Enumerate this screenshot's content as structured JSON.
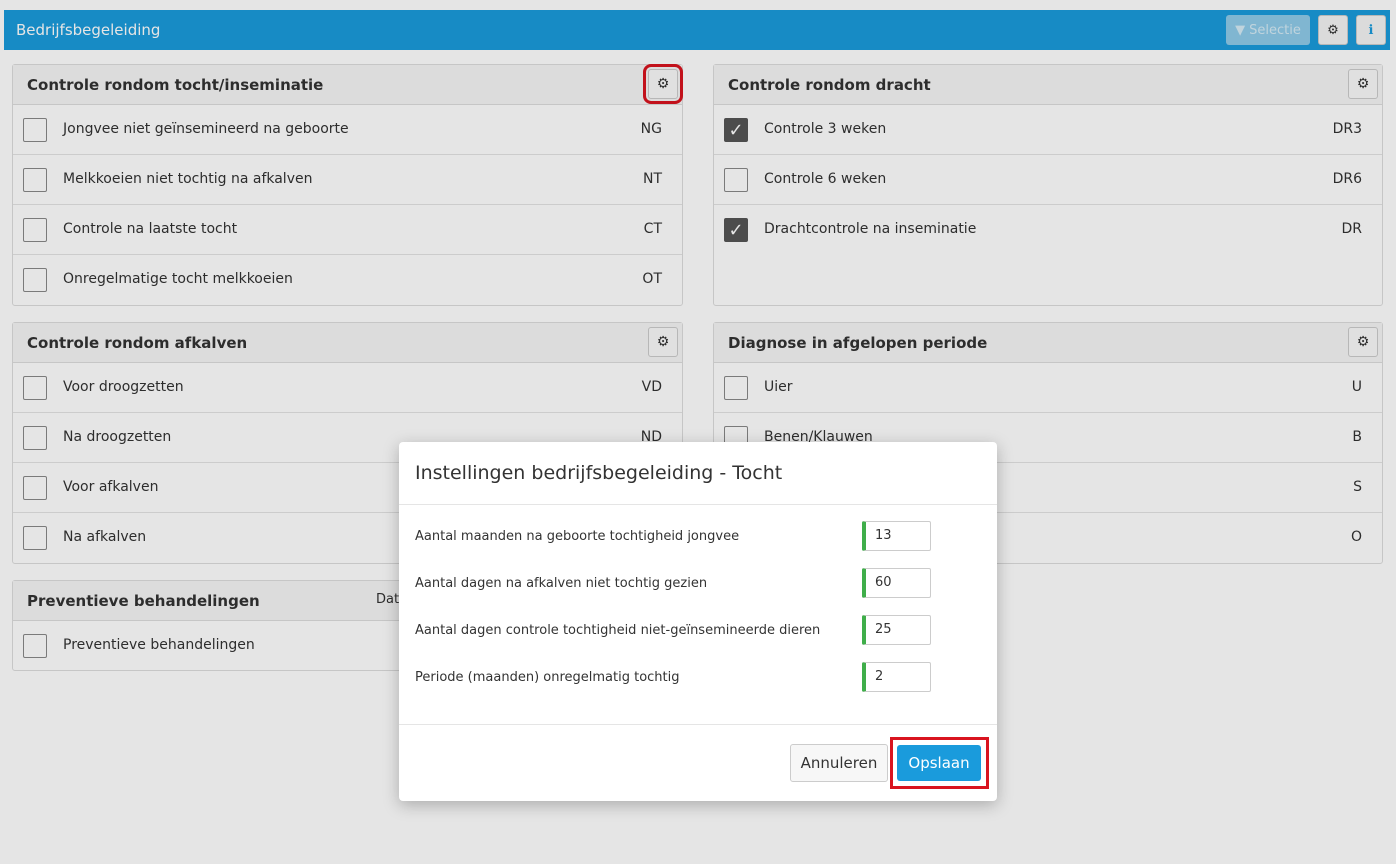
{
  "header": {
    "title": "Bedrijfsbegeleiding",
    "selectie_label": "Selectie",
    "accent": "#1a9bdc"
  },
  "panels": {
    "tocht": {
      "title": "Controle rondom tocht/inseminatie",
      "rows": [
        {
          "label": "Jongvee niet geïnsemineerd na geboorte",
          "code": "NG",
          "checked": false
        },
        {
          "label": "Melkkoeien niet tochtig na afkalven",
          "code": "NT",
          "checked": false
        },
        {
          "label": "Controle na laatste tocht",
          "code": "CT",
          "checked": false
        },
        {
          "label": "Onregelmatige tocht melkkoeien",
          "code": "OT",
          "checked": false
        }
      ]
    },
    "dracht": {
      "title": "Controle rondom dracht",
      "rows": [
        {
          "label": "Controle 3 weken",
          "code": "DR3",
          "checked": true
        },
        {
          "label": "Controle 6 weken",
          "code": "DR6",
          "checked": false
        },
        {
          "label": "Drachtcontrole na inseminatie",
          "code": "DR",
          "checked": true
        }
      ]
    },
    "afkalven": {
      "title": "Controle rondom afkalven",
      "rows": [
        {
          "label": "Voor droogzetten",
          "code": "VD",
          "checked": false
        },
        {
          "label": "Na droogzetten",
          "code": "ND",
          "checked": false
        },
        {
          "label": "Voor afkalven",
          "code": "",
          "checked": false
        },
        {
          "label": "Na afkalven",
          "code": "",
          "checked": false
        }
      ]
    },
    "diagnose": {
      "title": "Diagnose in afgelopen periode",
      "rows": [
        {
          "label": "Uier",
          "code": "U",
          "checked": false
        },
        {
          "label": "Benen/Klauwen",
          "code": "B",
          "checked": false
        },
        {
          "label": "",
          "code": "S",
          "checked": false
        },
        {
          "label": "",
          "code": "O",
          "checked": false
        }
      ]
    },
    "preventief": {
      "title": "Preventieve behandelingen",
      "extra": "Dat",
      "rows": [
        {
          "label": "Preventieve behandelingen",
          "code": "",
          "checked": false
        }
      ]
    }
  },
  "modal": {
    "title": "Instellingen bedrijfsbegeleiding - Tocht",
    "fields": [
      {
        "label": "Aantal maanden na geboorte tochtigheid jongvee",
        "value": "13"
      },
      {
        "label": "Aantal dagen na afkalven niet tochtig gezien",
        "value": "60"
      },
      {
        "label": "Aantal dagen controle tochtigheid niet-geïnsemineerde dieren",
        "value": "25"
      },
      {
        "label": "Periode (maanden) onregelmatig tochtig",
        "value": "2"
      }
    ],
    "cancel_label": "Annuleren",
    "save_label": "Opslaan"
  }
}
